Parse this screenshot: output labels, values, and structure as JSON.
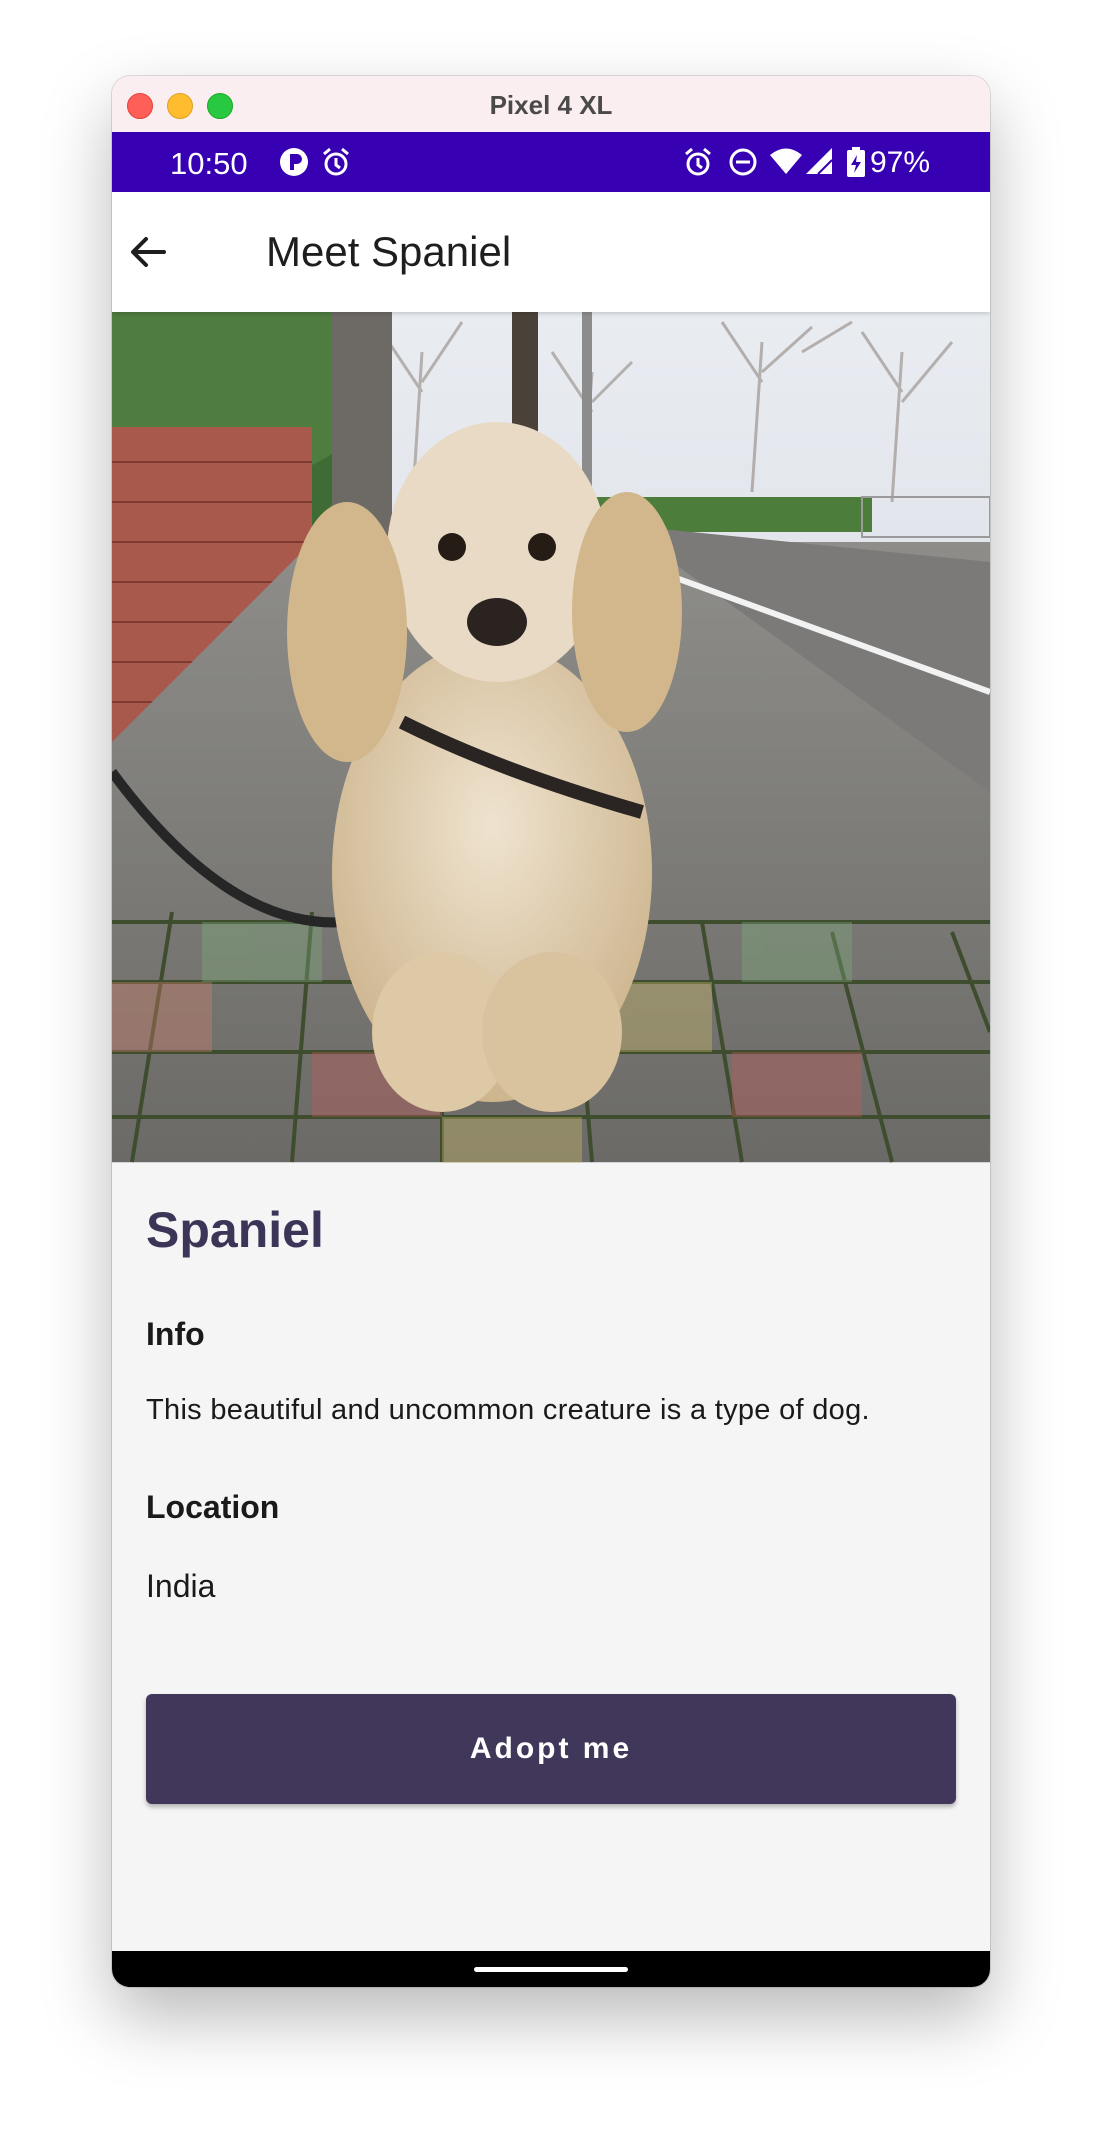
{
  "window": {
    "title": "Pixel 4 XL"
  },
  "status_bar": {
    "time": "10:50",
    "battery": "97%",
    "left_icons": [
      "app-notification-icon",
      "alarm-icon"
    ],
    "right_icons": [
      "alarm-icon",
      "do-not-disturb-icon",
      "wifi-icon",
      "signal-icon",
      "battery-charging-icon"
    ],
    "background": "#3700b3"
  },
  "app_bar": {
    "title": "Meet Spaniel",
    "back_icon": "arrow-back-icon"
  },
  "pet": {
    "name": "Spaniel",
    "info_heading": "Info",
    "info_text": "This beautiful and uncommon creature is a type of dog.",
    "location_heading": "Location",
    "location": "India"
  },
  "actions": {
    "adopt_label": "Adopt me"
  },
  "colors": {
    "accent": "#40375a",
    "status_bar": "#3700b3",
    "name": "#3d3557"
  }
}
